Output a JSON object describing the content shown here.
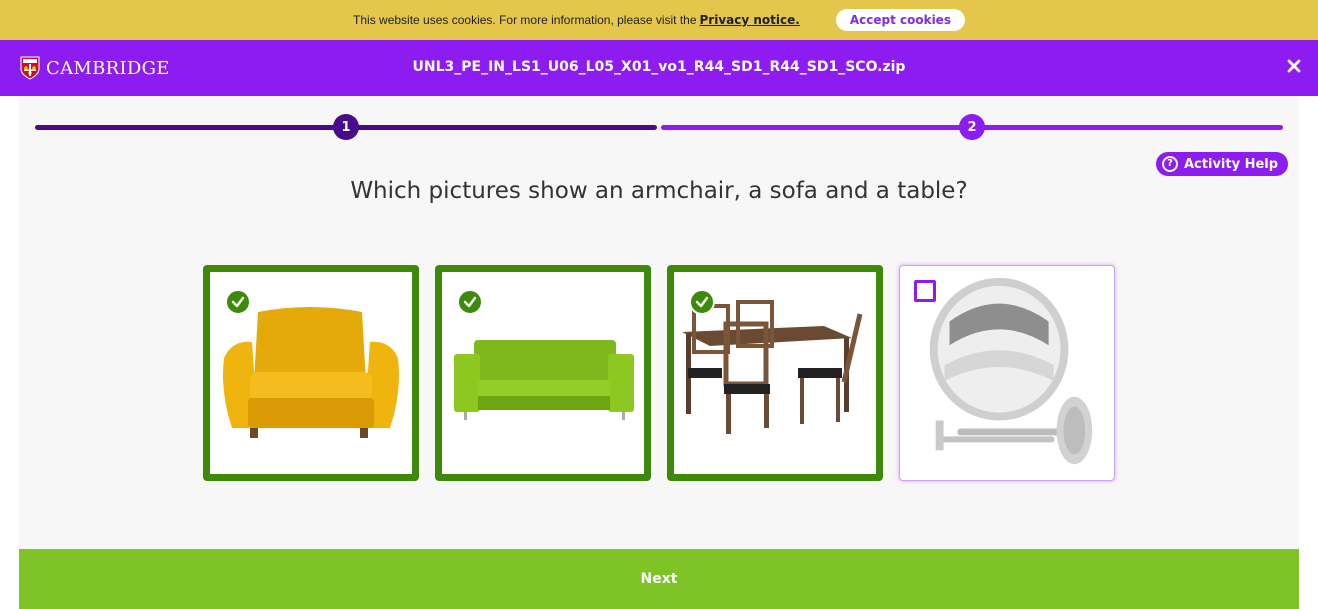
{
  "cookie_bar": {
    "text": "This website uses cookies. For more information, please visit the",
    "link_label": "Privacy notice.",
    "accept_label": "Accept cookies"
  },
  "header": {
    "brand": "CAMBRIDGE",
    "file_title": "UNL3_PE_IN_LS1_U06_L05_X01_vo1_R44_SD1_R44_SD1_SCO.zip",
    "close_icon": "close-icon",
    "color": "#8c1cf0"
  },
  "progress": {
    "steps": [
      "1",
      "2"
    ],
    "current_step": 2,
    "completed_color": "#4a0a8c",
    "active_color": "#8c1cf0"
  },
  "help": {
    "label": "Activity Help",
    "icon": "question-circle-icon"
  },
  "question": "Which pictures show an armchair, a sofa and a table?",
  "options": [
    {
      "name": "armchair",
      "selected": true
    },
    {
      "name": "sofa",
      "selected": true
    },
    {
      "name": "dining table",
      "selected": true
    },
    {
      "name": "mirror",
      "selected": false
    }
  ],
  "colors": {
    "selected_border": "#3d8a0a",
    "next_bar": "#7ec427",
    "cookie_bar": "#e3c64b"
  },
  "footer": {
    "next_label": "Next"
  }
}
